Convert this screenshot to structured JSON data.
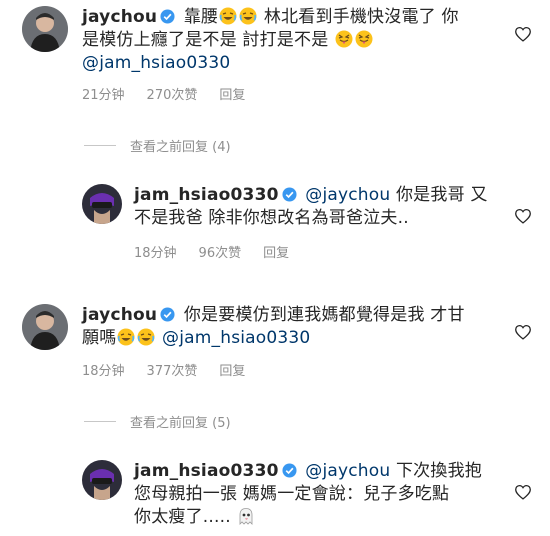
{
  "comments": [
    {
      "username": "jaychou",
      "text_a": "靠腰",
      "text_b": "林北看到手機快沒電了 你",
      "line2": "是模仿上癮了是不是 討打是不是",
      "mention": "@jam_hsiao0330",
      "time": "21分钟",
      "likes": "270次赞",
      "reply": "回复"
    },
    {
      "username": "jam_hsiao0330",
      "mention": "@jaychou",
      "text_a": "你是我哥 又",
      "line2": "不是我爸 除非你想改名為哥爸泣夫..",
      "time": "18分钟",
      "likes": "96次赞",
      "reply": "回复"
    },
    {
      "username": "jaychou",
      "text_a": "你是要模仿到連我媽都覺得是我 才甘",
      "line2": "願嗎",
      "mention": "@jam_hsiao0330",
      "time": "18分钟",
      "likes": "377次赞",
      "reply": "回复"
    },
    {
      "username": "jam_hsiao0330",
      "mention": "@jaychou",
      "text_a": "下次換我抱",
      "line2": "您母親拍一張 媽媽一定會說：兒子多吃點",
      "line3": "你太瘦了.....",
      "time": "",
      "likes": "",
      "reply": ""
    }
  ],
  "view_replies": [
    "查看之前回复 (4)",
    "查看之前回复 (5)"
  ],
  "icons": {
    "verified": "verified-badge-icon",
    "laugh": "tears-of-joy-emoji",
    "tongue": "squinting-tongue-emoji",
    "ghost": "ghost-emoji",
    "heart": "heart-outline-icon"
  },
  "colors": {
    "username": "#262626",
    "meta": "#8e8e8e",
    "mention": "#00376b",
    "verified": "#3897f0"
  }
}
